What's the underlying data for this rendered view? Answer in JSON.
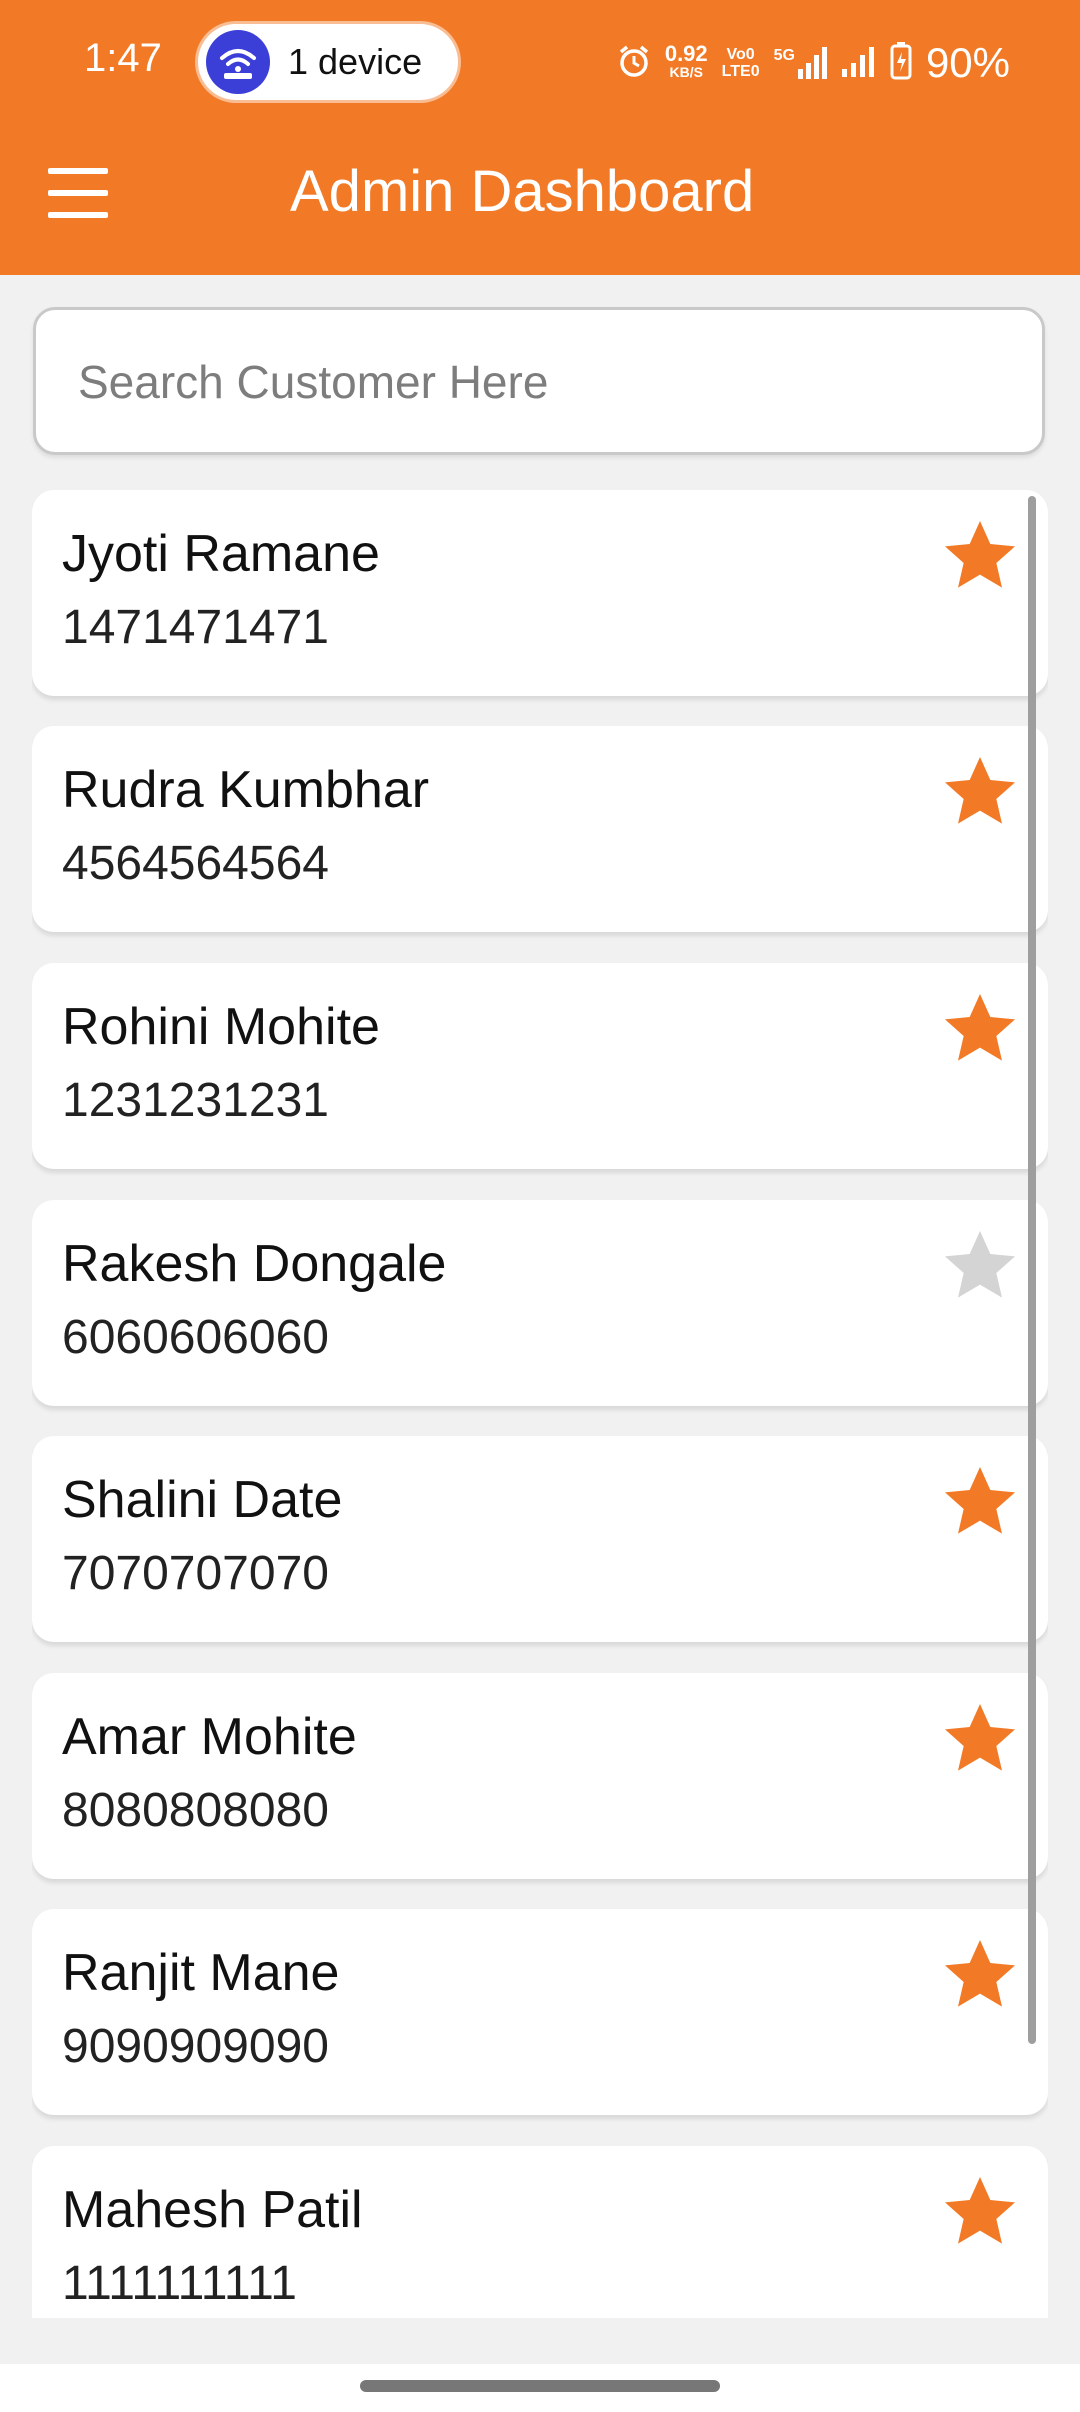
{
  "status_bar": {
    "time": "1:47",
    "hotspot": "1 device",
    "net_speed_value": "0.92",
    "net_speed_unit": "KB/S",
    "volte_top": "Vo0",
    "volte_bottom": "LTE0",
    "network": "5G",
    "battery": "90%"
  },
  "app_bar": {
    "title": "Admin Dashboard",
    "menu_icon": "hamburger-menu-icon",
    "color": "#F27A26"
  },
  "search": {
    "placeholder": "Search Customer Here",
    "value": ""
  },
  "customers": [
    {
      "name": "Jyoti Ramane",
      "phone": "1471471471",
      "favorite": true
    },
    {
      "name": "Rudra Kumbhar",
      "phone": "4564564564",
      "favorite": true
    },
    {
      "name": "Rohini Mohite",
      "phone": "1231231231",
      "favorite": true
    },
    {
      "name": "Rakesh Dongale",
      "phone": "6060606060",
      "favorite": false
    },
    {
      "name": "Shalini Date",
      "phone": "7070707070",
      "favorite": true
    },
    {
      "name": "Amar Mohite",
      "phone": "8080808080",
      "favorite": true
    },
    {
      "name": "Ranjit Mane",
      "phone": "9090909090",
      "favorite": true
    },
    {
      "name": "Mahesh Patil",
      "phone": "1111111111",
      "favorite": true
    }
  ],
  "colors": {
    "star_active": "#F27A26",
    "star_inactive": "#d4d4d4"
  }
}
